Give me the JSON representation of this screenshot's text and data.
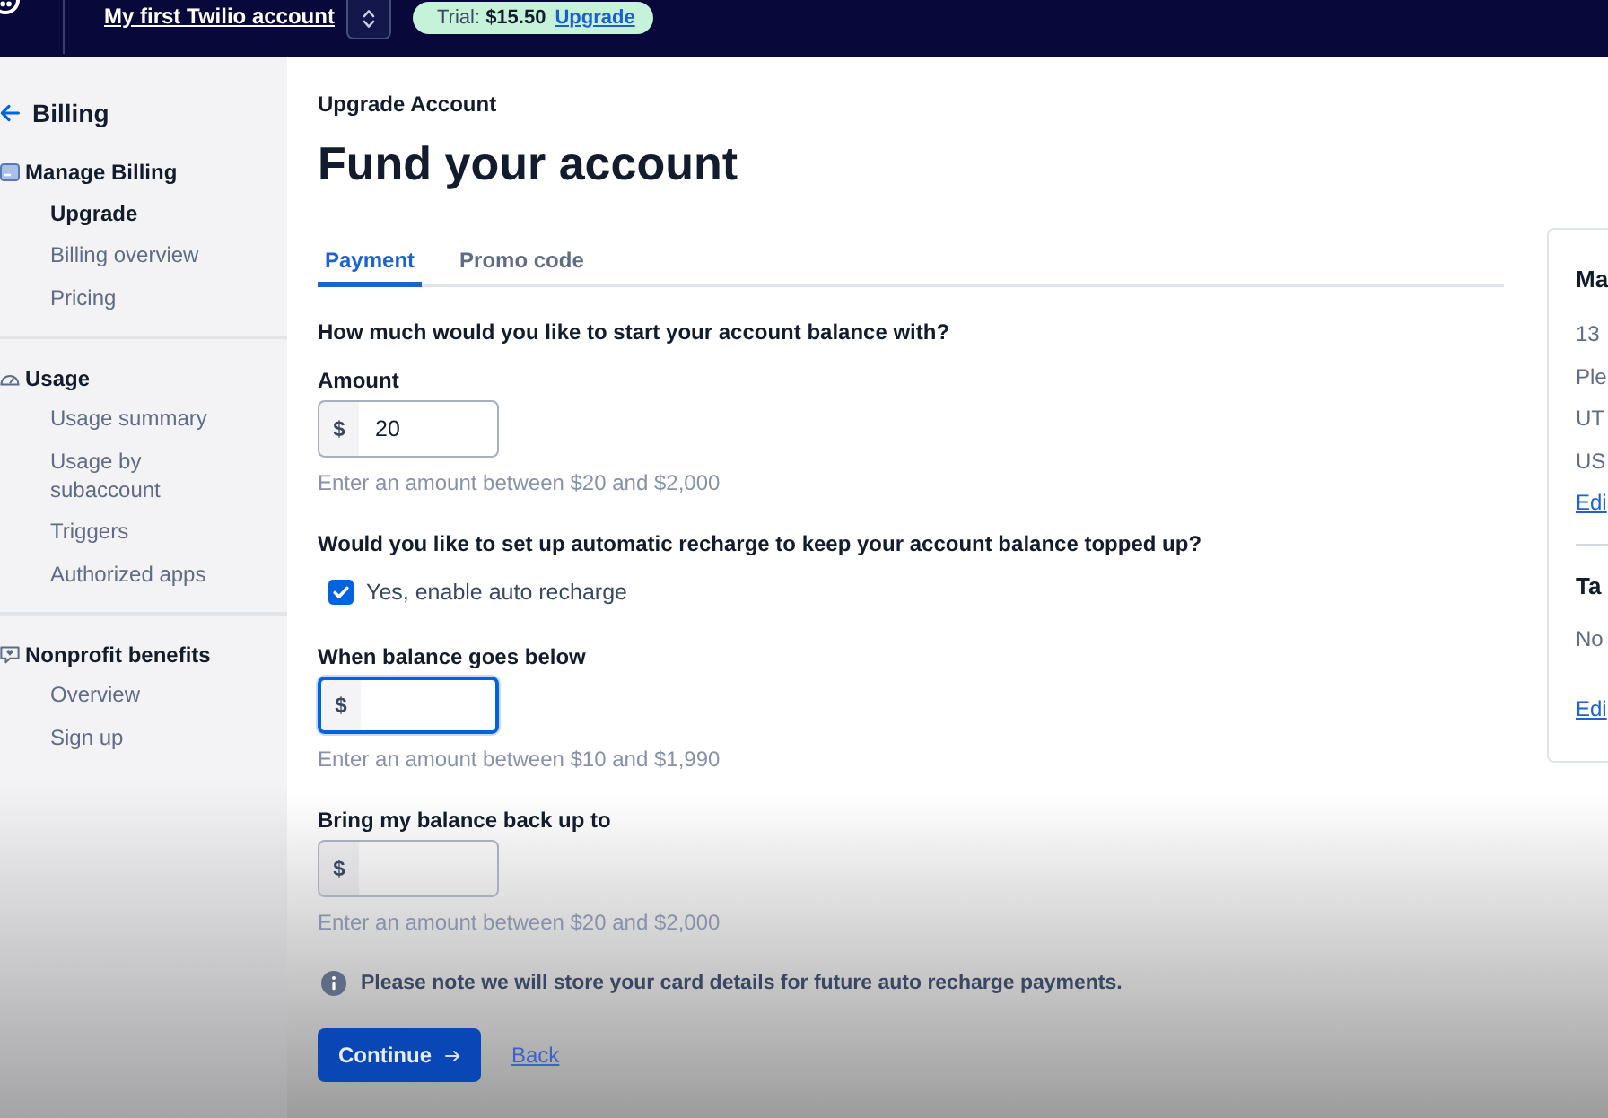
{
  "top_bar": {
    "account_name": "My first Twilio account",
    "trial": {
      "balance": "Trial: **$15.50**",
      "link": "Upgrade"
    }
  },
  "sidebar": {
    "back": "Billing",
    "sections": [
      {
        "title": "Manage Billing",
        "items": [
          {
            "label": "Upgrade",
            "selected": true
          },
          {
            "label": "Billing overview",
            "selected": false
          },
          {
            "label": "Pricing",
            "selected": false
          }
        ]
      },
      {
        "title": "Usage",
        "items": [
          {
            "label": "Usage summary",
            "selected": false
          },
          {
            "label": "Usage by subaccount",
            "selected": false
          },
          {
            "label": "Triggers",
            "selected": false
          },
          {
            "label": "Authorized apps",
            "selected": false
          }
        ]
      },
      {
        "title": "Nonprofit benefits",
        "items": [
          {
            "label": "Overview",
            "selected": false
          },
          {
            "label": "Sign up",
            "selected": false
          }
        ]
      }
    ]
  },
  "main": {
    "eyebrow": "Upgrade Account",
    "title": "Fund your account",
    "tabs": [
      {
        "label": "Payment",
        "selected": true
      },
      {
        "label": "Promo code",
        "selected": false
      }
    ],
    "form": [
      {
        "kind": "question",
        "text": "How much would you like to start your account balance with?"
      },
      {
        "kind": "amount",
        "label": "Amount",
        "prefix": "$",
        "value": "20",
        "help": "Enter an amount between $20 and $2,000",
        "focused": false
      },
      {
        "kind": "question",
        "text": "Would you like to set up automatic recharge to keep your account balance topped up?"
      },
      {
        "kind": "checkbox",
        "label": "Yes, enable auto recharge",
        "checked": true
      },
      {
        "kind": "amount",
        "label": "When balance goes below",
        "prefix": "$",
        "help": "Enter an amount between $10 and $1,990",
        "focused": true
      },
      {
        "kind": "amount",
        "label": "Bring my balance back up to",
        "prefix": "$",
        "help": "Enter an amount between $20 and $2,000",
        "focused": false
      },
      {
        "kind": "note",
        "text": "Please note we will store your card details for future auto recharge payments."
      }
    ],
    "actions": {
      "continue": "Continue",
      "back": "Back"
    }
  },
  "side_card": {
    "sections": [
      {
        "heading": "Ma",
        "lines": [
          "13",
          "Ple",
          "UT",
          "US"
        ],
        "link": "Edi"
      },
      {
        "heading": "Ta",
        "lines": [
          "No"
        ],
        "link": "Edi"
      }
    ]
  }
}
